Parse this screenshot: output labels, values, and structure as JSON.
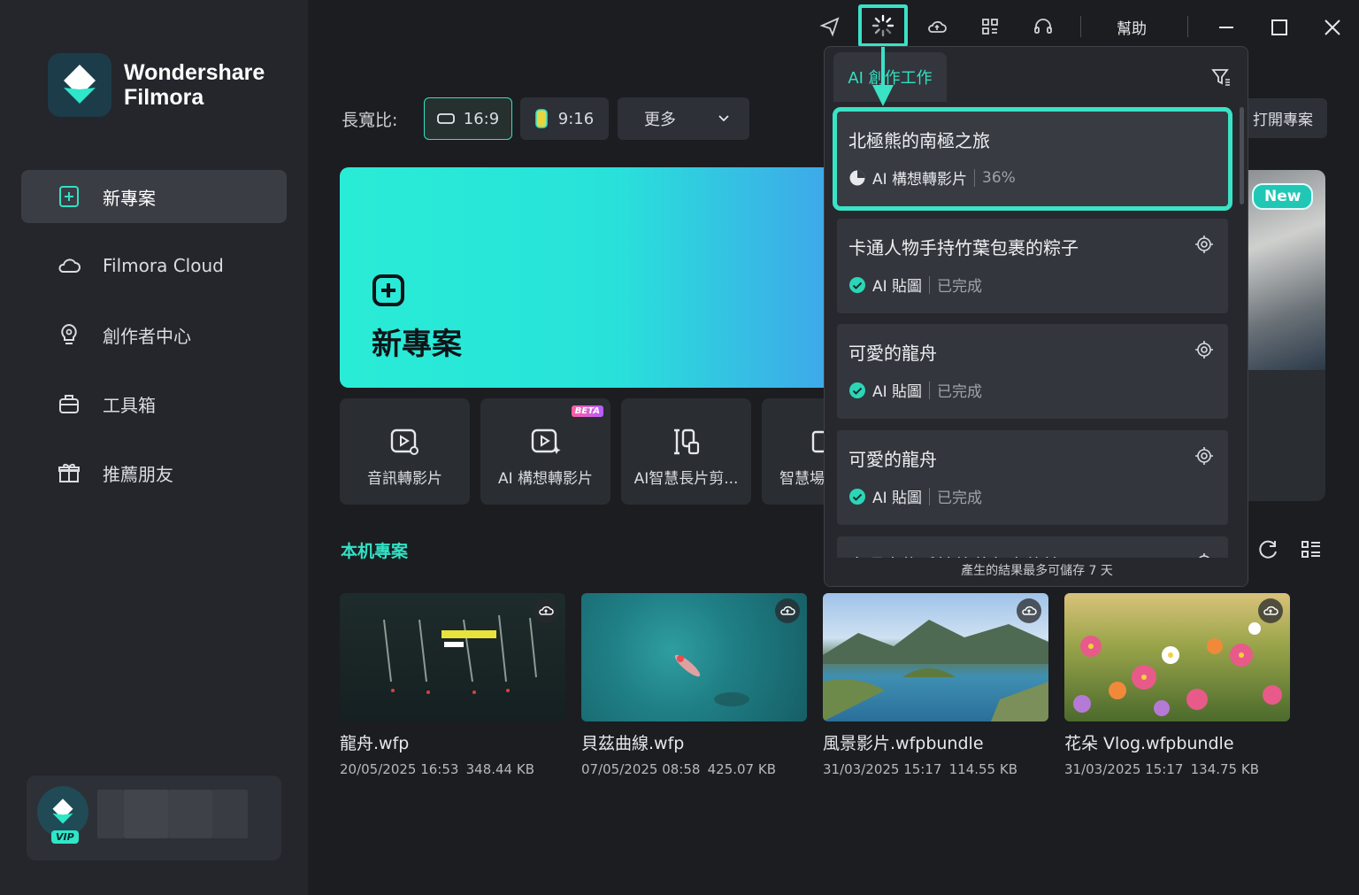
{
  "brand": {
    "line1": "Wondershare",
    "line2": "Filmora"
  },
  "sidebar": {
    "items": [
      {
        "label": "新專案",
        "icon": "new-project-icon",
        "active": true
      },
      {
        "label": "Filmora Cloud",
        "icon": "cloud-icon",
        "active": false
      },
      {
        "label": "創作者中心",
        "icon": "bulb-icon",
        "active": false
      },
      {
        "label": "工具箱",
        "icon": "toolbox-icon",
        "active": false
      },
      {
        "label": "推薦朋友",
        "icon": "gift-icon",
        "active": false
      }
    ],
    "vip_badge": "VIP"
  },
  "topbar": {
    "help_label": "幫助"
  },
  "aspect": {
    "label": "長寬比:",
    "options": [
      {
        "label": "16:9",
        "active": true
      },
      {
        "label": "9:16",
        "active": false
      }
    ],
    "more_label": "更多"
  },
  "hero": {
    "title": "新專案"
  },
  "open_project_label": "打開專案",
  "new_badge": "New",
  "tools": [
    {
      "label": "音訊轉影片",
      "badge": ""
    },
    {
      "label": "AI 構想轉影片",
      "badge": "BETA"
    },
    {
      "label": "AI智慧長片剪...",
      "badge": ""
    },
    {
      "label": "智慧場",
      "badge": ""
    }
  ],
  "local_projects": {
    "title": "本机專案",
    "items": [
      {
        "name": "龍舟.wfp",
        "date": "20/05/2025 16:53",
        "size": "348.44 KB"
      },
      {
        "name": "貝茲曲線.wfp",
        "date": "07/05/2025 08:58",
        "size": "425.07 KB"
      },
      {
        "name": "風景影片.wfpbundle",
        "date": "31/03/2025 15:17",
        "size": "114.55 KB"
      },
      {
        "name": "花朵 Vlog.wfpbundle",
        "date": "31/03/2025 15:17",
        "size": "134.75 KB"
      }
    ]
  },
  "ai_panel": {
    "tab_label": "AI 創作工作",
    "tasks": [
      {
        "title": "北極熊的南極之旅",
        "type": "AI 構想轉影片",
        "status": "36%",
        "state": "progress"
      },
      {
        "title": "卡通人物手持竹葉包裹的粽子",
        "type": "AI 貼圖",
        "status": "已完成",
        "state": "done"
      },
      {
        "title": "可愛的龍舟",
        "type": "AI 貼圖",
        "status": "已完成",
        "state": "done"
      },
      {
        "title": "可愛的龍舟",
        "type": "AI 貼圖",
        "status": "已完成",
        "state": "done"
      },
      {
        "title": "卡通人物手持竹葉包裹的粽子",
        "type": "",
        "status": "",
        "state": "partial"
      }
    ],
    "footer": "產生的結果最多可儲存 7 天"
  },
  "colors": {
    "accent": "#33e0c4",
    "bg": "#1b1d21",
    "sidebar": "#24262b"
  }
}
